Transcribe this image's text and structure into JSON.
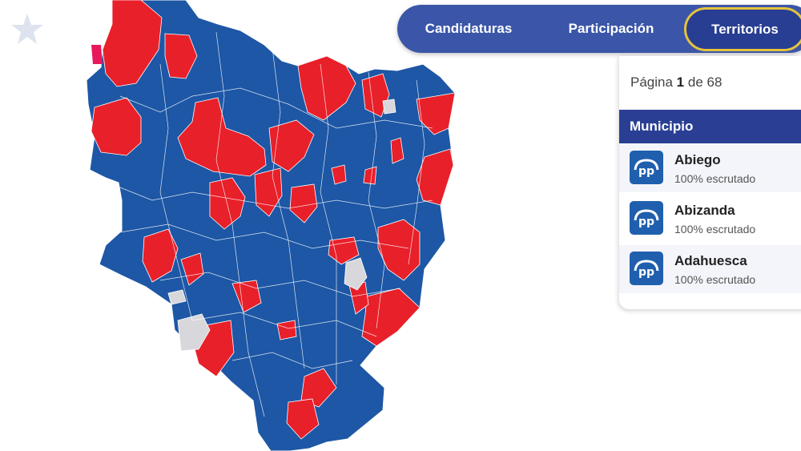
{
  "colors": {
    "party_pp": "#1d57a5",
    "party_psoe": "#e8202a",
    "no_data": "#d8d8dc",
    "other": "#e8185a",
    "tabs_bg": "#3b56a8",
    "tab_active_border": "#e5c33d",
    "header_bg": "#2a3f94"
  },
  "tabs": [
    {
      "label": "Candidaturas"
    },
    {
      "label": "Participación"
    },
    {
      "label": "Territorios",
      "active": true
    }
  ],
  "pager": {
    "prefix": "Página ",
    "current": "1",
    "suffix": " de 68"
  },
  "list": {
    "header": "Municipio",
    "items": [
      {
        "name": "Abiego",
        "status": "100% escrutado",
        "party_icon": "pp-logo-icon"
      },
      {
        "name": "Abizanda",
        "status": "100% escrutado",
        "party_icon": "pp-logo-icon"
      },
      {
        "name": "Adahuesca",
        "status": "100% escrutado",
        "party_icon": "pp-logo-icon"
      }
    ]
  }
}
